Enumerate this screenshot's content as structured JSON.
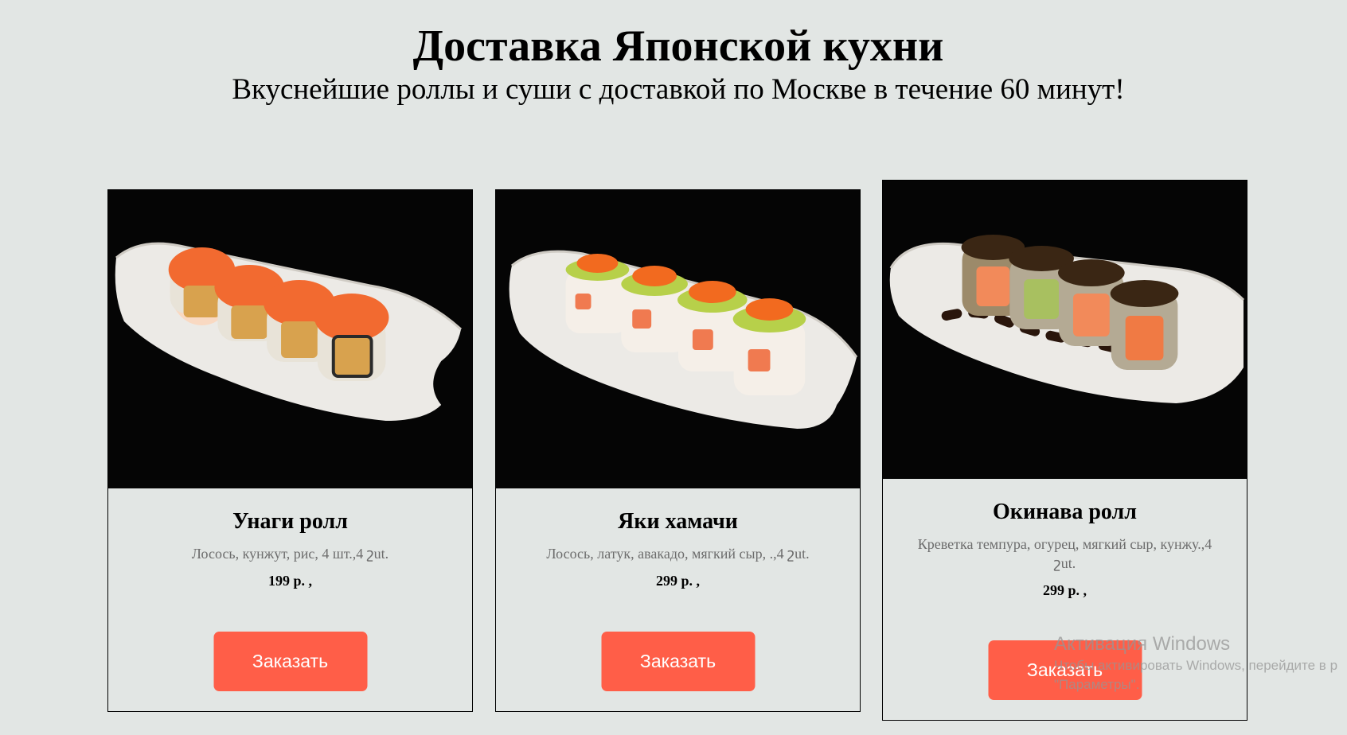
{
  "header": {
    "title": "Доставка Японской кухни",
    "subtitle": "Вкуснейшие роллы и суши с доставкой по Москве в течение 60 минут!"
  },
  "products": [
    {
      "name": "Унаги ролл",
      "description": "Лосось, кунжут, рис, 4 шт.,4 շut.",
      "price": "199 р. ,",
      "button_label": "Заказать",
      "image": "salmon-roll-photo"
    },
    {
      "name": "Яки хамачи",
      "description": "Лосось, латук, авакадо, мягкий сыр, .,4 շut.",
      "price": "299 р. ,",
      "button_label": "Заказать",
      "image": "tobiko-lime-roll-photo"
    },
    {
      "name": "Окинава ролл",
      "description": "Креветка темпура, огурец, мягкий сыр, кунжу.,4 շut.",
      "price": "299 р. ,",
      "button_label": "Заказать",
      "image": "unagi-sauce-roll-photo"
    }
  ],
  "os_watermark": {
    "title": "Активация Windows",
    "line1": "Чтобы активировать Windows, перейдите в р",
    "line2": "\"Параметры\"."
  },
  "colors": {
    "page_background": "#e2e6e4",
    "button": "#ff5e48",
    "photo_background": "#050505"
  }
}
